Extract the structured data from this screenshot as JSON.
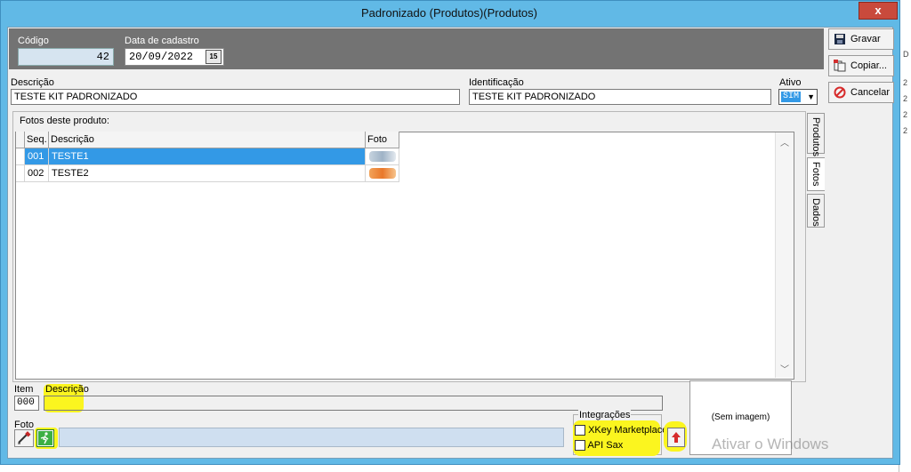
{
  "window": {
    "title": "Padronizado (Produtos)(Produtos)",
    "close_label": "x"
  },
  "header": {
    "code_label": "Código",
    "code_value": "42",
    "date_label": "Data de cadastro",
    "date_value": "20/09/2022",
    "calendar_icon": "calendar-icon"
  },
  "fields": {
    "descricao_label": "Descrição",
    "descricao_value": "TESTE KIT PADRONIZADO",
    "identificacao_label": "Identificação",
    "identificacao_value": "TESTE KIT PADRONIZADO",
    "ativo_label": "Ativo",
    "ativo_value": "SIM"
  },
  "buttons": {
    "gravar": "Gravar",
    "copiar": "Copiar...",
    "cancelar": "Cancelar"
  },
  "tabs": [
    "Produtos",
    "Fotos",
    "Dados"
  ],
  "photos": {
    "section_label": "Fotos deste produto:",
    "columns": [
      "Seq.",
      "Descrição",
      "Foto"
    ],
    "rows": [
      {
        "seq": "001",
        "descricao": "TESTE1",
        "selected": true
      },
      {
        "seq": "002",
        "descricao": "TESTE2",
        "selected": false
      }
    ]
  },
  "bottom": {
    "item_label": "Item",
    "item_value": "000",
    "descricao_label": "Descrição",
    "descricao_value": "",
    "foto_label": "Foto",
    "integracoes_label": "Integrações",
    "xkey_label": "XKey Marketplace",
    "apisax_label": "API Sax",
    "sem_imagem": "(Sem imagem)"
  },
  "watermark": {
    "line1": "Ativar o Windows"
  },
  "background": {
    "items": [
      "D",
      "2",
      "2",
      "2",
      "2"
    ]
  }
}
